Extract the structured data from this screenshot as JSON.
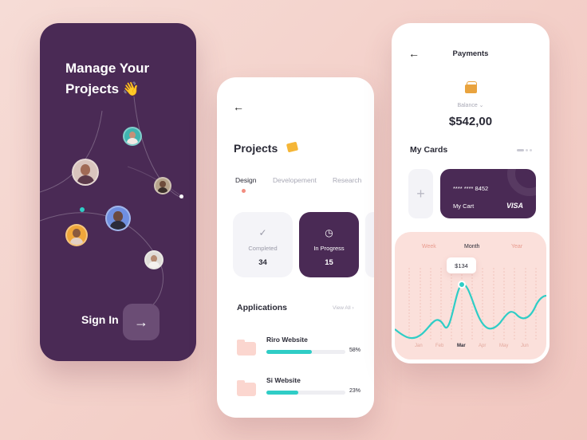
{
  "screen1": {
    "title": "Manage Your Projects",
    "title_emoji": "👋",
    "signin_label": "Sign In",
    "arrow_icon": "→"
  },
  "screen2": {
    "back_icon": "←",
    "title": "Projects",
    "tabs": [
      {
        "label": "Design",
        "active": true
      },
      {
        "label": "Developement",
        "active": false
      },
      {
        "label": "Research",
        "active": false
      }
    ],
    "stats": [
      {
        "label": "Completed",
        "value": "34",
        "icon": "✓",
        "active": false
      },
      {
        "label": "In Progress",
        "value": "15",
        "icon": "◷",
        "active": true
      }
    ],
    "applications_title": "Applications",
    "view_all_label": "View All",
    "applications": [
      {
        "name": "Riro Website",
        "percent_label": "58%",
        "progress": 0.58
      },
      {
        "name": "Si Website",
        "percent_label": "23%",
        "progress": 0.23
      }
    ]
  },
  "screen3": {
    "back_icon": "←",
    "title": "Payments",
    "balance_label": "Balance",
    "balance_value": "$542,00",
    "cards_title": "My Cards",
    "add_icon": "+",
    "card": {
      "number": "**** **** 8452",
      "name": "My Cart",
      "brand": "VISA"
    },
    "periods": [
      {
        "label": "Week",
        "active": false
      },
      {
        "label": "Month",
        "active": true
      },
      {
        "label": "Year",
        "active": false
      }
    ],
    "tooltip_value": "$134",
    "months": [
      {
        "label": "Jan",
        "active": false
      },
      {
        "label": "Feb",
        "active": false
      },
      {
        "label": "Mar",
        "active": true
      },
      {
        "label": "Apr",
        "active": false
      },
      {
        "label": "May",
        "active": false
      },
      {
        "label": "Jun",
        "active": false
      }
    ]
  },
  "colors": {
    "purple": "#4a2a55",
    "teal": "#2fcdc6",
    "coral": "#f28d80",
    "background": "#f6dcd6"
  }
}
